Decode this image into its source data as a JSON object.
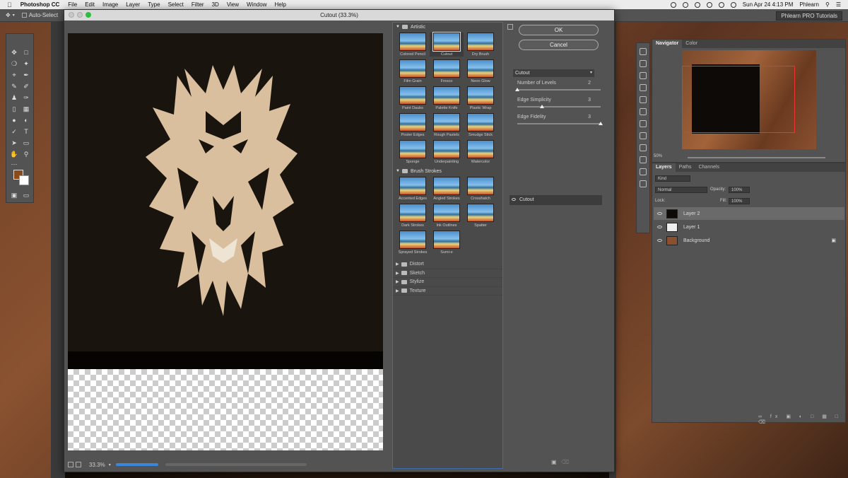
{
  "menubar": {
    "app_name": "Photoshop CC",
    "items": [
      "File",
      "Edit",
      "Image",
      "Layer",
      "Type",
      "Select",
      "Filter",
      "3D",
      "View",
      "Window",
      "Help"
    ],
    "datetime": "Sun Apr 24  4:13 PM",
    "user": "Phlearn"
  },
  "options_bar": {
    "auto_select_label": "Auto-Select",
    "workspace": "Phlearn PRO Tutorials"
  },
  "dialog": {
    "title": "Cutout (33.3%)",
    "ok_label": "OK",
    "cancel_label": "Cancel",
    "selected_filter": "Cutout",
    "zoom": "33.3%",
    "params": [
      {
        "label": "Number of Levels",
        "value": "2",
        "fraction": 0.0
      },
      {
        "label": "Edge Simplicity",
        "value": "3",
        "fraction": 0.3
      },
      {
        "label": "Edge Fidelity",
        "value": "3",
        "fraction": 1.0
      }
    ],
    "effect_layer": "Cutout"
  },
  "gallery": {
    "artistic": {
      "label": "Artistic",
      "filters": [
        "Colored Pencil",
        "Cutout",
        "Dry Brush",
        "Film Grain",
        "Fresco",
        "Neon Glow",
        "Paint Daubs",
        "Palette Knife",
        "Plastic Wrap",
        "Poster Edges",
        "Rough Pastels",
        "Smudge Stick",
        "Sponge",
        "Underpainting",
        "Watercolor"
      ]
    },
    "brush_strokes": {
      "label": "Brush Strokes",
      "filters": [
        "Accented Edges",
        "Angled Strokes",
        "Crosshatch",
        "Dark Strokes",
        "Ink Outlines",
        "Spatter",
        "Sprayed Strokes",
        "Sumi-e"
      ]
    },
    "closed_folders": [
      "Distort",
      "Sketch",
      "Stylize",
      "Texture"
    ]
  },
  "navigator": {
    "tabs": [
      "Navigator",
      "Color"
    ],
    "zoom": "50%"
  },
  "layers_panel": {
    "tabs": [
      "Layers",
      "Paths",
      "Channels"
    ],
    "kind_label": "Kind",
    "blend_mode": "Normal",
    "opacity_label": "Opacity:",
    "opacity": "100%",
    "lock_label": "Lock:",
    "fill_label": "Fill:",
    "fill": "100%",
    "layers": [
      "Layer 2",
      "Layer 1",
      "Background"
    ]
  }
}
